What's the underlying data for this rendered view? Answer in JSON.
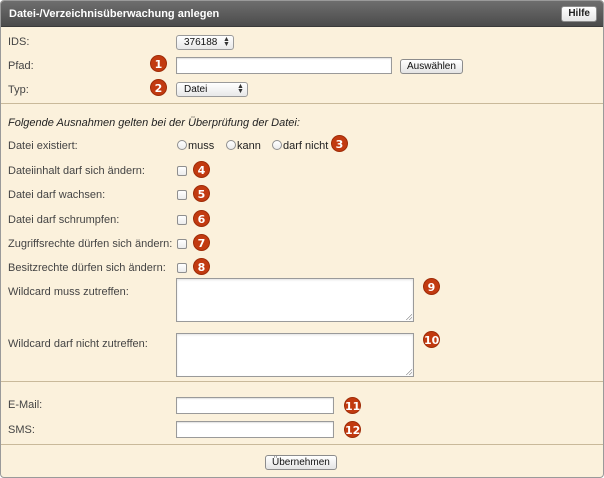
{
  "header": {
    "title": "Datei-/Verzeichnisüberwachung anlegen",
    "help_label": "Hilfe"
  },
  "basic": {
    "ids_label": "IDS:",
    "ids_value": "376188",
    "path_label": "Pfad:",
    "path_value": "",
    "select_button": "Auswählen",
    "type_label": "Typ:",
    "type_value": "Datei"
  },
  "exceptions": {
    "heading": "Folgende Ausnahmen gelten bei der Überprüfung der Datei:",
    "exists_label": "Datei existiert:",
    "exists_options": [
      "muss",
      "kann",
      "darf nicht"
    ],
    "content_change_label": "Dateiinhalt darf sich ändern:",
    "grow_label": "Datei darf wachsen:",
    "shrink_label": "Datei darf schrumpfen:",
    "access_rights_label": "Zugriffsrechte dürfen sich ändern:",
    "owner_rights_label": "Besitzrechte dürfen sich ändern:",
    "wildcard_match_label": "Wildcard muss zutreffen:",
    "wildcard_match_value": "",
    "wildcard_nomatch_label": "Wildcard darf nicht zutreffen:",
    "wildcard_nomatch_value": ""
  },
  "notify": {
    "email_label": "E-Mail:",
    "email_value": "",
    "sms_label": "SMS:",
    "sms_value": ""
  },
  "footer": {
    "submit_label": "Übernehmen"
  },
  "badges": [
    "1",
    "2",
    "3",
    "4",
    "5",
    "6",
    "7",
    "8",
    "9",
    "10",
    "11",
    "12"
  ],
  "colors": {
    "panel_bg": "#fbf1dc",
    "titlebar": "#5a5a5a",
    "badge": "#c23a10"
  }
}
